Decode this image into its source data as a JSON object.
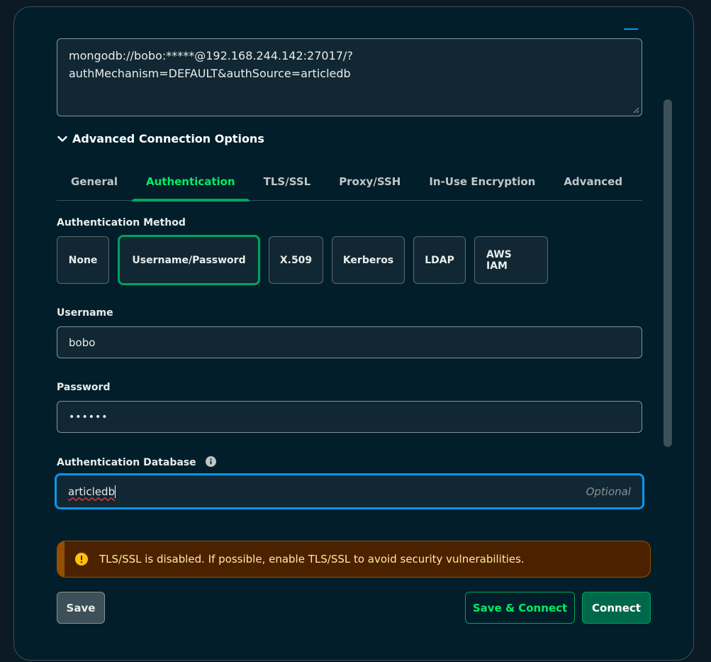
{
  "connection_string": {
    "line1": "mongodb://bobo:*****@192.168.244.142:27017/?",
    "line2": "authMechanism=DEFAULT&authSource=articledb"
  },
  "advanced": {
    "title": "Advanced Connection Options",
    "tabs": [
      "General",
      "Authentication",
      "TLS/SSL",
      "Proxy/SSH",
      "In-Use Encryption",
      "Advanced"
    ],
    "active_tab": "Authentication"
  },
  "auth": {
    "method_label": "Authentication Method",
    "methods": [
      "None",
      "Username/Password",
      "X.509",
      "Kerberos",
      "LDAP",
      "AWS IAM"
    ],
    "selected_method": "Username/Password",
    "username_label": "Username",
    "username_value": "bobo",
    "password_label": "Password",
    "password_value": "••••••",
    "db_label": "Authentication Database",
    "db_value": "articledb",
    "db_placeholder": "Optional"
  },
  "banner": {
    "text": "TLS/SSL is disabled. If possible, enable TLS/SSL to avoid security vulnerabilities."
  },
  "buttons": {
    "save": "Save",
    "save_connect": "Save & Connect",
    "connect": "Connect"
  },
  "colors": {
    "accent_green": "#00ed64",
    "focus_blue": "#0498ec",
    "warning_bg": "#4c2100"
  }
}
